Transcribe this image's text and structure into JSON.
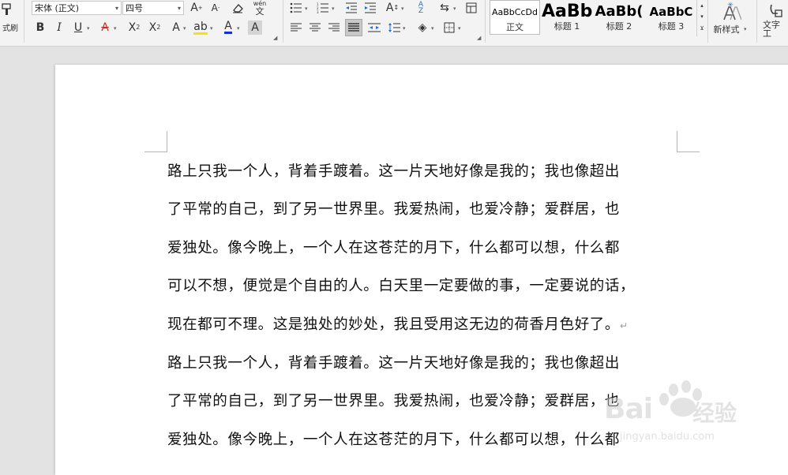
{
  "ribbon": {
    "format_painter_label": "式刷",
    "font_name": "宋体 (正文)",
    "font_size": "四号",
    "phonetic_label": "wén",
    "styles": [
      {
        "preview": "AaBbCcDd",
        "name": "正文"
      },
      {
        "preview": "AaBb",
        "name": "标题 1"
      },
      {
        "preview": "AaBb(",
        "name": "标题 2"
      },
      {
        "preview": "AaBbC",
        "name": "标题 3"
      }
    ],
    "new_style_label": "新样式",
    "text_tool_label": "文字工"
  },
  "document": {
    "lines": [
      "路上只我一个人，背着手踱着。这一片天地好像是我的；我也像超出",
      "了平常的自己，到了另一世界里。我爱热闹，也爱冷静；爱群居，也",
      "爱独处。像今晚上，一个人在这苍茫的月下，什么都可以想，什么都",
      "可以不想，便觉是个自由的人。白天里一定要做的事，一定要说的话，",
      "现在都可不理。这是独处的妙处，我且受用这无边的荷香月色好了。",
      "路上只我一个人，背着手踱着。这一片天地好像是我的；我也像超出",
      "了平常的自己，到了另一世界里。我爱热闹，也爱冷静；爱群居，也",
      "爱独处。像今晚上，一个人在这苍茫的月下，什么都可以想，什么都"
    ],
    "paragraph_mark": "↵"
  },
  "watermark": {
    "text_cn": "经验",
    "brand": "Bai",
    "sub": "jingyan.baidu.com"
  },
  "colors": {
    "font_color": "#1a2fd0",
    "accent_active": "#c8c8c8"
  }
}
